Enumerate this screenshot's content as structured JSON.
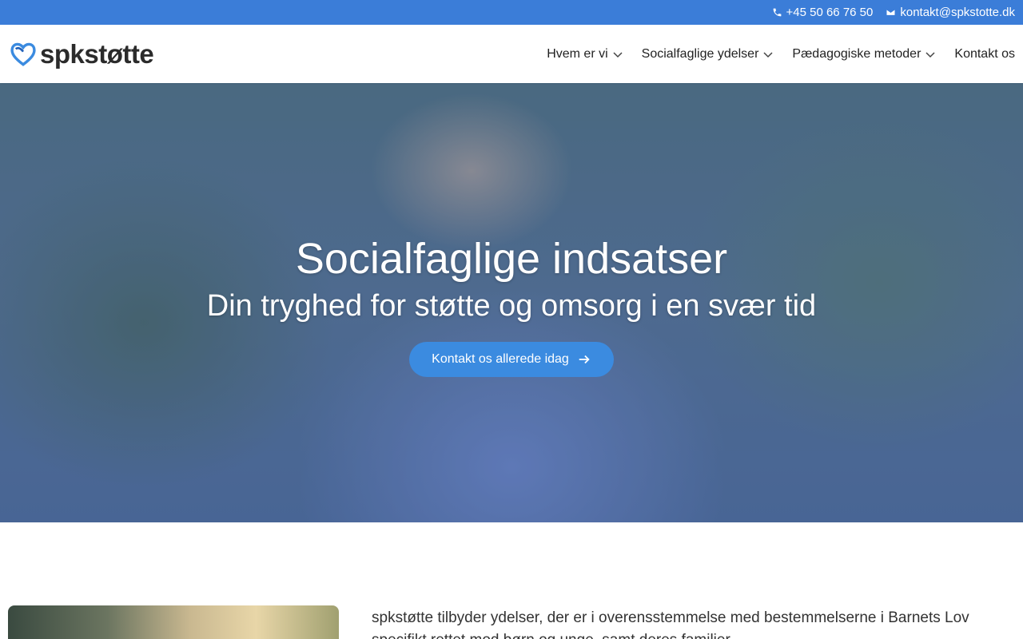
{
  "topbar": {
    "phone": "+45 50 66 76 50",
    "email": "kontakt@spkstotte.dk",
    "phone_icon": "phone-icon",
    "email_icon": "mail-icon"
  },
  "header": {
    "logo_text": "spkstøtte",
    "nav": [
      {
        "label": "Hvem er vi",
        "has_dropdown": true
      },
      {
        "label": "Socialfaglige ydelser",
        "has_dropdown": true
      },
      {
        "label": "Pædagogiske metoder",
        "has_dropdown": true
      },
      {
        "label": "Kontakt os",
        "has_dropdown": false
      }
    ]
  },
  "hero": {
    "title": "Socialfaglige indsatser",
    "subtitle": "Din tryghed for støtte og omsorg i en svær tid",
    "cta_label": "Kontakt os allerede idag"
  },
  "content": {
    "intro": "spkstøtte tilbyder ydelser, der er i overensstemmelse med bestemmelserne i Barnets Lov specifikt rettet mod børn og unge, samt deres familier."
  },
  "colors": {
    "topbar": "#3b7dd8",
    "cta": "#3b8be0",
    "logo_heart": "#3b8be0"
  }
}
